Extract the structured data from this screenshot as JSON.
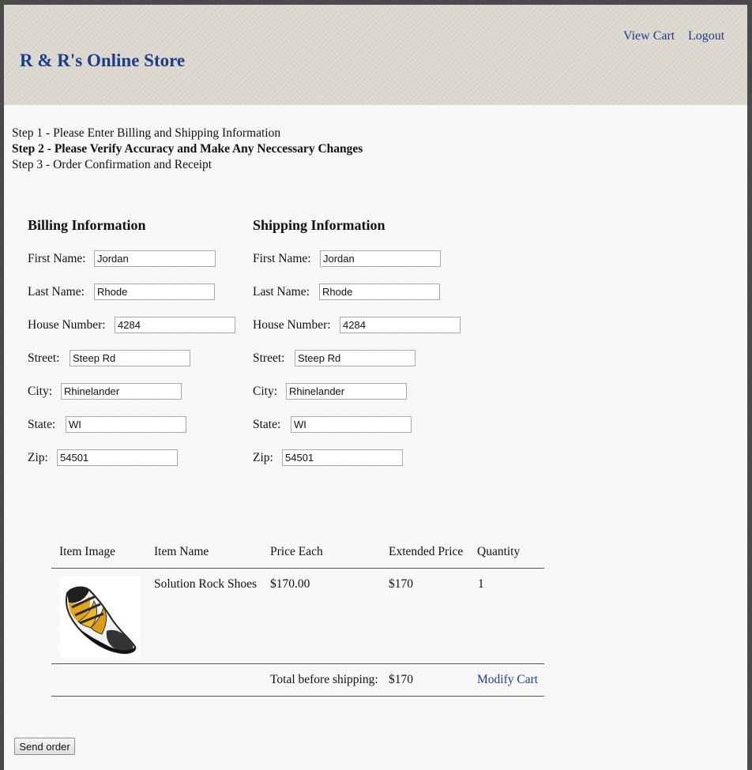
{
  "header": {
    "store_title": "R & R's Online Store",
    "nav": {
      "view_cart": "View Cart",
      "logout": "Logout"
    }
  },
  "steps": [
    "Step 1 - Please Enter Billing and Shipping Information",
    "Step 2 - Please Verify Accuracy and Make Any Neccessary Changes",
    "Step 3 - Order Confirmation and Receipt"
  ],
  "billing": {
    "heading": "Billing Information",
    "fields": [
      {
        "label": "First Name:",
        "value": "Jordan"
      },
      {
        "label": "Last Name:",
        "value": "Rhode"
      },
      {
        "label": "House Number:",
        "value": "4284"
      },
      {
        "label": "Street:",
        "value": "Steep Rd"
      },
      {
        "label": "City:",
        "value": "Rhinelander"
      },
      {
        "label": "State:",
        "value": "WI"
      },
      {
        "label": "Zip:",
        "value": "54501"
      }
    ]
  },
  "shipping": {
    "heading": "Shipping Information",
    "fields": [
      {
        "label": "First Name:",
        "value": "Jordan"
      },
      {
        "label": "Last Name:",
        "value": "Rhode"
      },
      {
        "label": "House Number:",
        "value": "4284"
      },
      {
        "label": "Street:",
        "value": "Steep Rd"
      },
      {
        "label": "City:",
        "value": "Rhinelander"
      },
      {
        "label": "State:",
        "value": "WI"
      },
      {
        "label": "Zip:",
        "value": "54501"
      }
    ]
  },
  "cart_table": {
    "headers": [
      "Item Image",
      "Item Name",
      "Price Each",
      "Extended Price",
      "Quantity"
    ],
    "rows": [
      {
        "image": "climbing-shoe-image",
        "name": "Solution Rock Shoes",
        "price_each": "$170.00",
        "extended_price": "$170",
        "quantity": "1"
      }
    ],
    "total_label": "Total before shipping:",
    "total_value": "$170",
    "modify_cart": "Modify Cart"
  },
  "send_order_label": "Send order",
  "colors": {
    "link": "#1d3c8c",
    "header_bg": "#dcd8d0",
    "page_bg": "#fbfbfb",
    "frame": "#4a4a4a"
  }
}
